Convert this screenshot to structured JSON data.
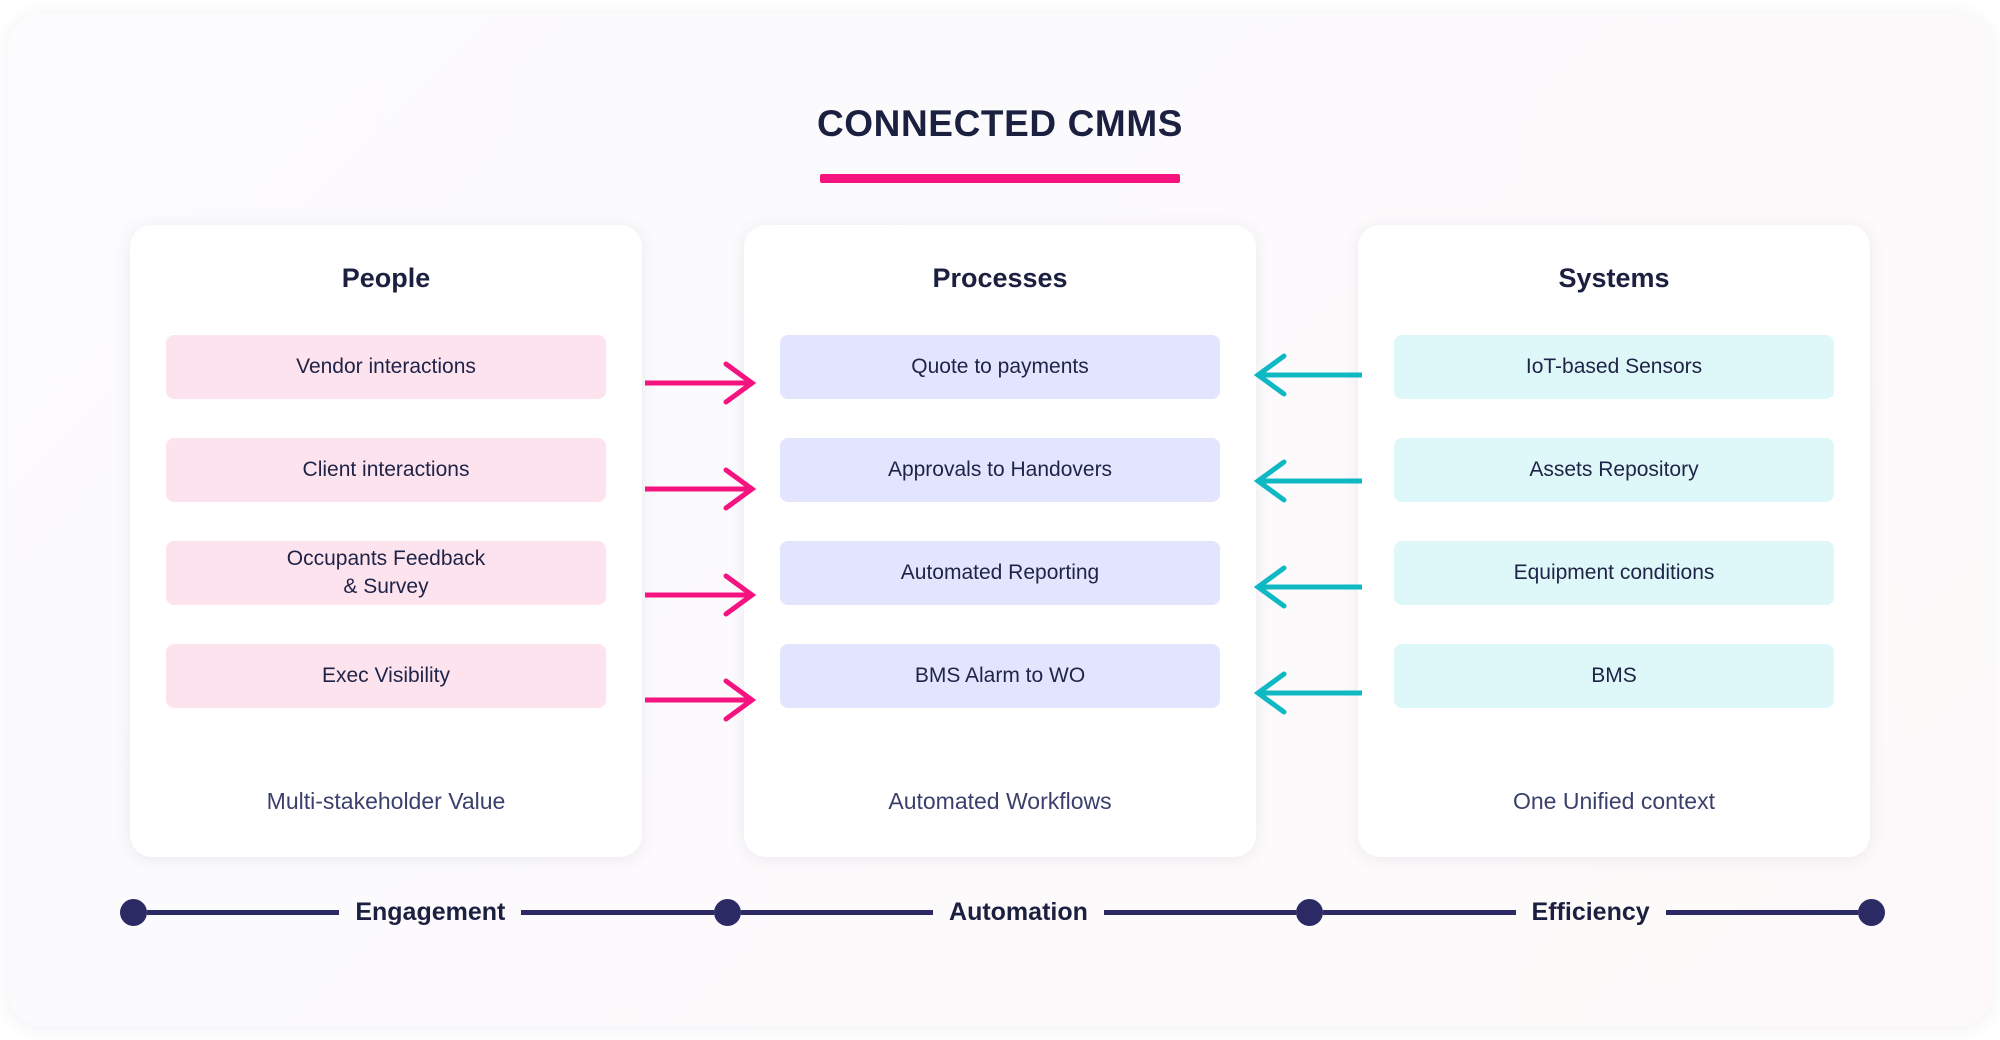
{
  "header": {
    "title": "CONNECTED CMMS",
    "accent_color": "#f5147f",
    "title_color": "#1c2040"
  },
  "columns": [
    {
      "id": "people",
      "title": "People",
      "pill_color": "#fde3ee",
      "items": [
        {
          "label": "Vendor interactions"
        },
        {
          "label": "Client interactions"
        },
        {
          "label": "Occupants Feedback\n& Survey"
        },
        {
          "label": "Exec Visibility"
        }
      ],
      "footer": "Multi-stakeholder Value"
    },
    {
      "id": "processes",
      "title": "Processes",
      "pill_color": "#e2e5fd",
      "items": [
        {
          "label": "Quote to payments"
        },
        {
          "label": "Approvals to Handovers"
        },
        {
          "label": "Automated Reporting"
        },
        {
          "label": "BMS Alarm to WO"
        }
      ],
      "footer": "Automated Workflows"
    },
    {
      "id": "systems",
      "title": "Systems",
      "pill_color": "#def7f8",
      "items": [
        {
          "label": "IoT-based Sensors"
        },
        {
          "label": "Assets Repository"
        },
        {
          "label": "Equipment conditions"
        },
        {
          "label": "BMS"
        }
      ],
      "footer": "One Unified context"
    }
  ],
  "connectors": {
    "left_to_center": {
      "direction": "right",
      "color": "#f5147f",
      "count": 4
    },
    "right_to_center": {
      "direction": "left",
      "color": "#0fb9c4",
      "count": 4
    }
  },
  "timeline": {
    "line_color": "#2c2a64",
    "dot_color": "#2c2a64",
    "segments": [
      {
        "label": "Engagement"
      },
      {
        "label": "Automation"
      },
      {
        "label": "Efficiency"
      }
    ]
  }
}
